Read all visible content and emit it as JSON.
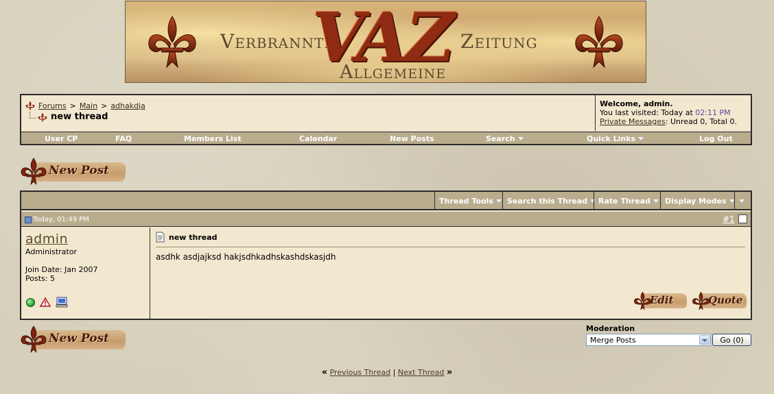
{
  "banner": {
    "word_left": "Verbrannte",
    "word_center": "VAZ",
    "word_right": "Zeitung",
    "word_bottom": "Allgemeine"
  },
  "breadcrumb": {
    "items": [
      "Forums",
      "Main",
      "adhakdja"
    ],
    "separator": ">",
    "current": "new thread"
  },
  "welcome": {
    "greeting": "Welcome, admin.",
    "last_visited_prefix": "You last visited: Today at",
    "last_visited_time": "02:11 PM",
    "pm_link": "Private Messages",
    "pm_status": ": Unread 0, Total 0."
  },
  "menu": {
    "items": [
      {
        "label": "User CP",
        "dropdown": false
      },
      {
        "label": "FAQ",
        "dropdown": false
      },
      {
        "label": "Members List",
        "dropdown": false
      },
      {
        "label": "Calendar",
        "dropdown": false
      },
      {
        "label": "New Posts",
        "dropdown": false
      },
      {
        "label": "Search",
        "dropdown": true
      },
      {
        "label": "Quick Links",
        "dropdown": true
      },
      {
        "label": "Log Out",
        "dropdown": false
      }
    ]
  },
  "new_post_label": "New Post",
  "thread_tools": {
    "items": [
      "Thread Tools",
      "Search this Thread",
      "Rate Thread",
      "Display Modes"
    ]
  },
  "post": {
    "date": "Today, 01:49 PM",
    "number": "#1",
    "username": "admin",
    "user_title": "Administrator",
    "join_date": "Join Date: Jan 2007",
    "posts": "Posts: 5",
    "title": "new thread",
    "message": "asdhk asdjajksd hakjsdhkadhskashdskasjdh",
    "edit_label": "Edit",
    "quote_label": "Quote"
  },
  "moderation": {
    "label": "Moderation",
    "selected": "Merge Posts",
    "go_label": "Go (0)"
  },
  "thread_nav": {
    "prev": "Previous Thread",
    "divider": "|",
    "next": "Next Thread",
    "left_quote": "«",
    "right_quote": "»"
  },
  "colors": {
    "accent_red": "#8e2b12",
    "bar_tan": "#b9ad8e",
    "panel_cream": "#f2e8cf",
    "page_bg": "#d6cfba"
  },
  "icons": {
    "fleur": "fleur-de-lis-icon",
    "online": "online-status-icon",
    "report": "report-warning-icon",
    "ip": "ip-computer-icon",
    "doc": "post-document-icon"
  }
}
